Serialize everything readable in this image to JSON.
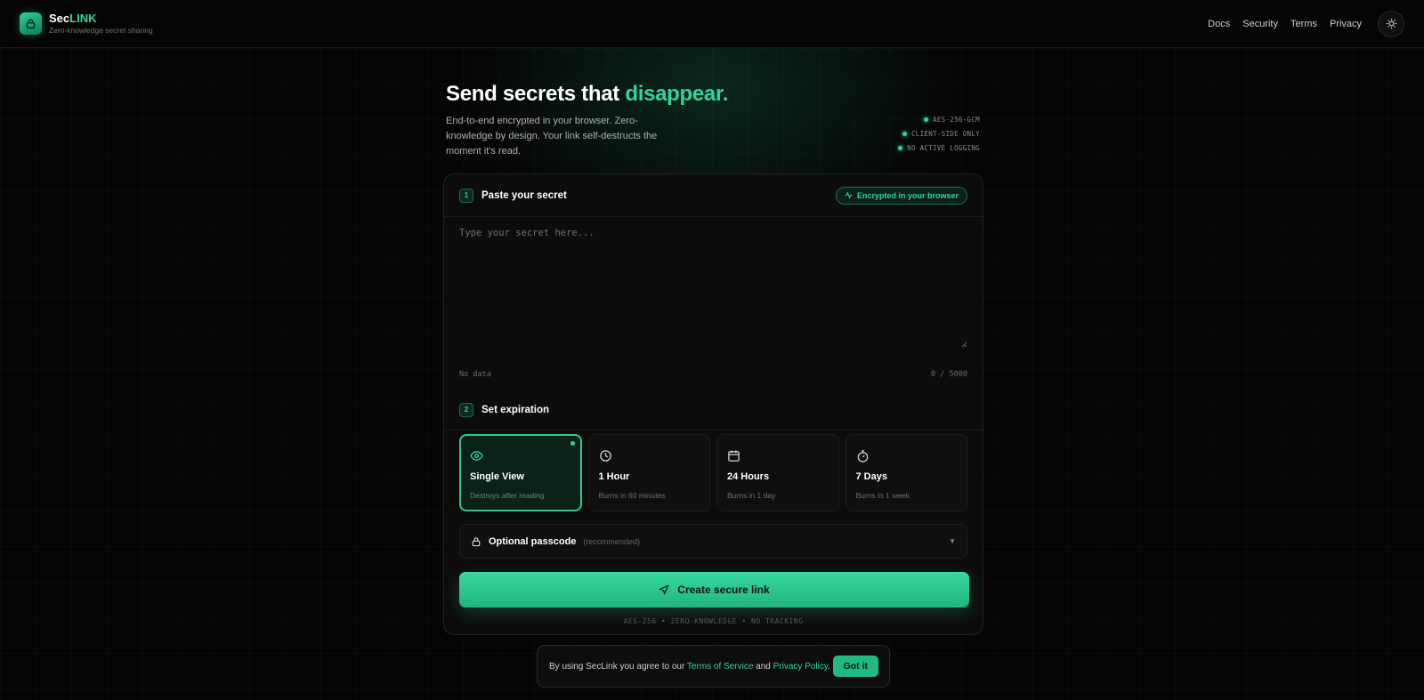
{
  "header": {
    "brand_prefix": "Sec",
    "brand_accent": "LINK",
    "tagline": "Zero-knowledge secret sharing",
    "nav": [
      "Docs",
      "Security",
      "Terms",
      "Privacy"
    ],
    "theme_icon": "sun-icon"
  },
  "hero": {
    "title_main": "Send secrets that ",
    "title_accent": "disappear.",
    "description": "End-to-end encrypted in your browser. Zero-knowledge by design. Your link self-destructs the moment it's read.",
    "badges": [
      "AES-256-GCM",
      "CLIENT-SIDE ONLY",
      "NO ACTIVE LOGGING"
    ]
  },
  "step1": {
    "number": "1",
    "title": "Paste your secret",
    "pill": "Encrypted in your browser",
    "placeholder": "Type your secret here...",
    "status": "No data",
    "counter": "0 / 5000"
  },
  "step2": {
    "number": "2",
    "title": "Set expiration",
    "options": [
      {
        "title": "Single View",
        "sub": "Destroys after reading",
        "icon": "eye-icon",
        "selected": true
      },
      {
        "title": "1 Hour",
        "sub": "Burns in 60 minutes",
        "icon": "clock-icon",
        "selected": false
      },
      {
        "title": "24 Hours",
        "sub": "Burns in 1 day",
        "icon": "calendar-icon",
        "selected": false
      },
      {
        "title": "7 Days",
        "sub": "Burns in 1 week",
        "icon": "timer-icon",
        "selected": false
      }
    ]
  },
  "passcode": {
    "label": "Optional passcode",
    "hint": "(recommended)"
  },
  "cta": {
    "label": "Create secure link"
  },
  "footnote": "AES-256 • ZERO-KNOWLEDGE • NO TRACKING",
  "consent": {
    "prefix": "By using SecLink you agree to our ",
    "terms": "Terms of Service",
    "middle": " and ",
    "privacy": "Privacy Policy",
    "suffix": ".",
    "button": "Got it"
  },
  "colors": {
    "accent": "#34d399",
    "background": "#050505",
    "card": "#0c0c0c"
  }
}
